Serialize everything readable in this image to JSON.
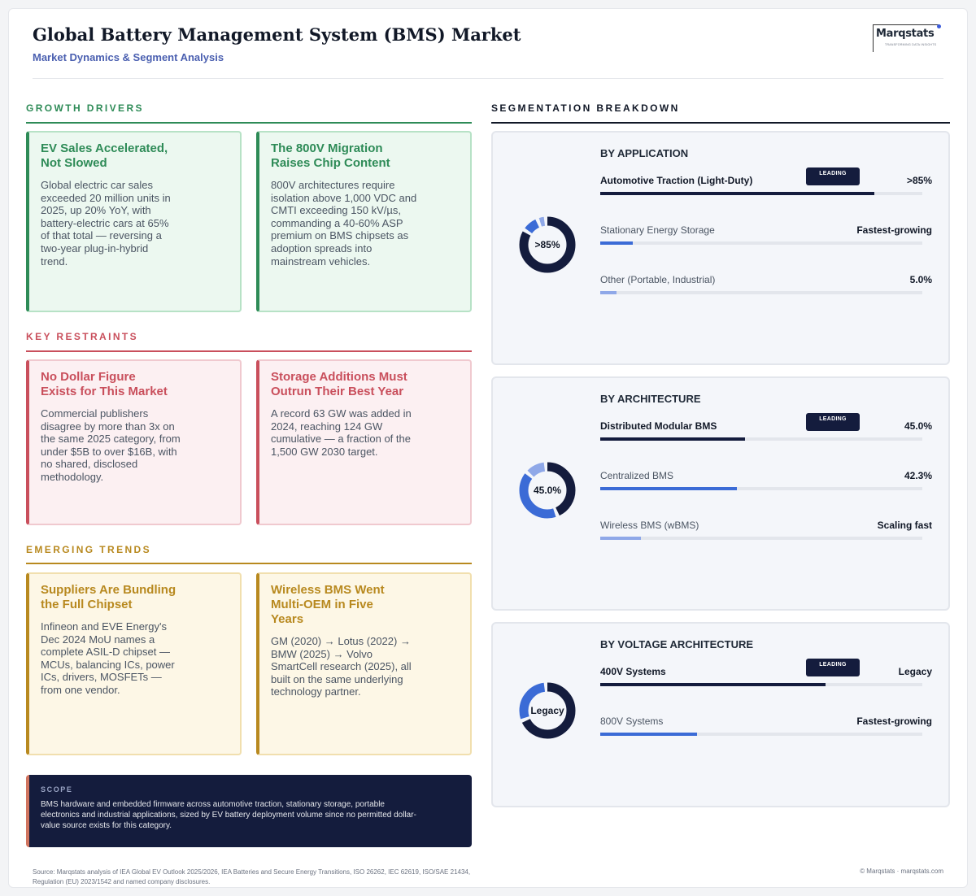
{
  "header": {
    "title": "Global Battery Management System (BMS) Market",
    "subtitle": "Market Dynamics & Segment Analysis",
    "logo_text": "Marqstats",
    "logo_tagline": "TRANSFORMING DATA INSIGHTS"
  },
  "drivers": {
    "heading": "GROWTH DRIVERS",
    "cards": [
      {
        "title": "EV Sales Accelerated, Not Slowed",
        "body": "Global electric car sales exceeded 20 million units in 2025, up 20% YoY, with battery-electric cars at 65% of that total — reversing a two-year plug-in-hybrid trend."
      },
      {
        "title": "The 800V Migration Raises Chip Content",
        "body": "800V architectures require isolation above 1,000 VDC and CMTI exceeding 150 kV/µs, commanding a 40-60% ASP premium on BMS chipsets as adoption spreads into mainstream vehicles."
      }
    ]
  },
  "restraints": {
    "heading": "KEY RESTRAINTS",
    "cards": [
      {
        "title": "No Dollar Figure Exists for This Market",
        "body": "Commercial publishers disagree by more than 3x on the same 2025 category, from under $5B to over $16B, with no shared, disclosed methodology."
      },
      {
        "title": "Storage Additions Must Outrun Their Best Year",
        "body": "A record 63 GW was added in 2024, reaching 124 GW cumulative — a fraction of the 1,500 GW 2030 target."
      }
    ]
  },
  "trends": {
    "heading": "EMERGING TRENDS",
    "cards": [
      {
        "title": "Suppliers Are Bundling the Full Chipset",
        "body": "Infineon and EVE Energy's Dec 2024 MoU names a complete ASIL-D chipset — MCUs, balancing ICs, power ICs, drivers, MOSFETs — from one vendor."
      },
      {
        "title": "Wireless BMS Went Multi-OEM in Five Years",
        "body": "GM (2020) → Lotus (2022) → BMW (2025) → Volvo SmartCell research (2025), all built on the same underlying technology partner."
      }
    ]
  },
  "scope": {
    "heading": "SCOPE",
    "text": "BMS hardware and embedded firmware across automotive traction, stationary storage, portable electronics and industrial applications, sized by EV battery deployment volume since no permitted dollar-value source exists for this category."
  },
  "segmentation": {
    "heading": "SEGMENTATION BREAKDOWN",
    "badge_label": "LEADING",
    "panels": [
      {
        "title": "BY APPLICATION",
        "donut_label": ">85%",
        "rows": [
          {
            "name": "Automotive Traction (Light-Duty)",
            "value": ">85%",
            "fill_pct": 85,
            "leading": true
          },
          {
            "name": "Stationary Energy Storage",
            "value": "Fastest-growing",
            "fill_pct": 10,
            "leading": false
          },
          {
            "name": "Other (Portable, Industrial)",
            "value": "5.0%",
            "fill_pct": 5,
            "leading": false
          }
        ]
      },
      {
        "title": "BY ARCHITECTURE",
        "donut_label": "45.0%",
        "rows": [
          {
            "name": "Distributed Modular BMS",
            "value": "45.0%",
            "fill_pct": 45,
            "leading": true
          },
          {
            "name": "Centralized BMS",
            "value": "42.3%",
            "fill_pct": 42.3,
            "leading": false
          },
          {
            "name": "Wireless BMS (wBMS)",
            "value": "Scaling fast",
            "fill_pct": 12.7,
            "leading": false
          }
        ]
      },
      {
        "title": "BY VOLTAGE ARCHITECTURE",
        "donut_label": "Legacy",
        "rows": [
          {
            "name": "400V Systems",
            "value": "Legacy",
            "fill_pct": 70,
            "leading": true
          },
          {
            "name": "800V Systems",
            "value": "Fastest-growing",
            "fill_pct": 30,
            "leading": false
          }
        ]
      }
    ]
  },
  "footer": {
    "source": "Source: Marqstats analysis of IEA Global EV Outlook 2025/2026, IEA Batteries and Secure Energy Transitions, ISO 26262, IEC 62619, ISO/SAE 21434, Regulation (EU) 2023/1542 and named company disclosures.",
    "copyright": "© Marqstats · marqstats.com"
  },
  "colors": {
    "navy": "#141c3d",
    "blue": "#3b6bd6",
    "light_blue": "#8fa8e8",
    "green": "#2e8b57",
    "red": "#c94f5c",
    "gold": "#b8891f"
  }
}
